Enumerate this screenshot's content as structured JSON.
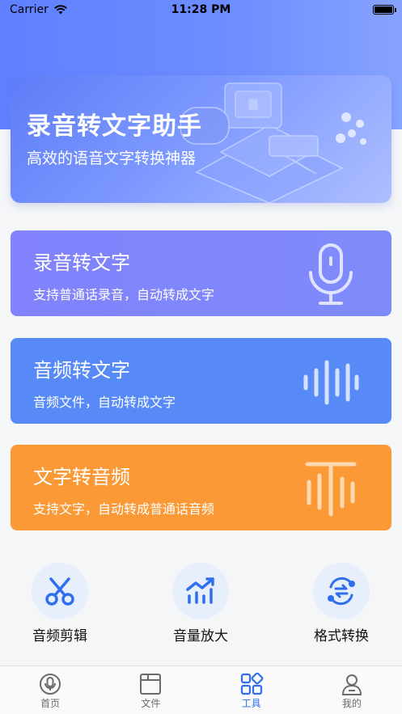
{
  "status_bar": {
    "carrier": "Carrier",
    "time": "11:28 PM"
  },
  "banner": {
    "title": "录音转文字助手",
    "subtitle": "高效的语音文字转换神器"
  },
  "cards": [
    {
      "title": "录音转文字",
      "desc": "支持普通话录音，自动转成文字",
      "color": "#8182fc"
    },
    {
      "title": "音频转文字",
      "desc": "音频文件，自动转成文字",
      "color": "#578af6"
    },
    {
      "title": "文字转音频",
      "desc": "支持文字，自动转成普通话音频",
      "color": "#fb9937"
    }
  ],
  "tools": [
    {
      "label": "音频剪辑",
      "icon": "scissors-icon"
    },
    {
      "label": "音量放大",
      "icon": "volume-up-chart-icon"
    },
    {
      "label": "格式转换",
      "icon": "convert-icon"
    }
  ],
  "tabs": [
    {
      "label": "首页",
      "icon": "home-mic-icon",
      "active": false
    },
    {
      "label": "文件",
      "icon": "folder-icon",
      "active": false
    },
    {
      "label": "工具",
      "icon": "tools-grid-icon",
      "active": true
    },
    {
      "label": "我的",
      "icon": "user-icon",
      "active": false
    }
  ],
  "colors": {
    "accent": "#2f6fee",
    "tool_icon": "#2f6fee"
  }
}
